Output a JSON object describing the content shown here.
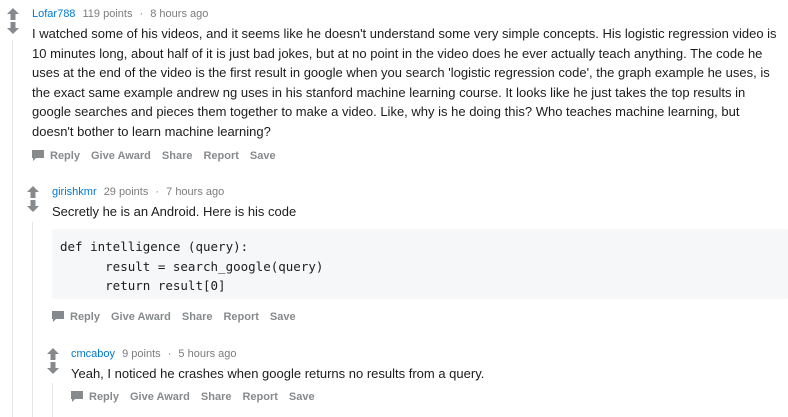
{
  "comments": [
    {
      "user": "Lofar788",
      "points": "119 points",
      "sep": "·",
      "time": "8 hours ago",
      "body": "I watched some of his videos, and it seems like he doesn't understand some very simple concepts. His logistic regression video is 10 minutes long, about half of it is just bad jokes, but at no point in the video does he ever actually teach anything. The code he uses at the end of the video is the first result in google when you search 'logistic regression code', the graph example he uses, is the exact same example andrew ng uses in his stanford machine learning course. It looks like he just takes the top results in google searches and pieces them together to make a video. Like, why is he doing this? Who teaches machine learning, but doesn't bother to learn machine learning?",
      "actions": {
        "reply": "Reply",
        "award": "Give Award",
        "share": "Share",
        "report": "Report",
        "save": "Save"
      }
    },
    {
      "user": "girishkmr",
      "points": "29 points",
      "sep": "·",
      "time": "7 hours ago",
      "body": "Secretly he is an Android. Here is his code",
      "code": "def intelligence (query):\n      result = search_google(query)\n      return result[0]",
      "actions": {
        "reply": "Reply",
        "award": "Give Award",
        "share": "Share",
        "report": "Report",
        "save": "Save"
      }
    },
    {
      "user": "cmcaboy",
      "points": "9 points",
      "sep": "·",
      "time": "5 hours ago",
      "body": "Yeah, I noticed he crashes when google returns no results from a query.",
      "actions": {
        "reply": "Reply",
        "award": "Give Award",
        "share": "Share",
        "report": "Report",
        "save": "Save"
      }
    }
  ],
  "colors": {
    "username": "#0079d3",
    "meta": "#7c7c7c",
    "action": "#878a8c",
    "arrow": "#878a8c"
  }
}
